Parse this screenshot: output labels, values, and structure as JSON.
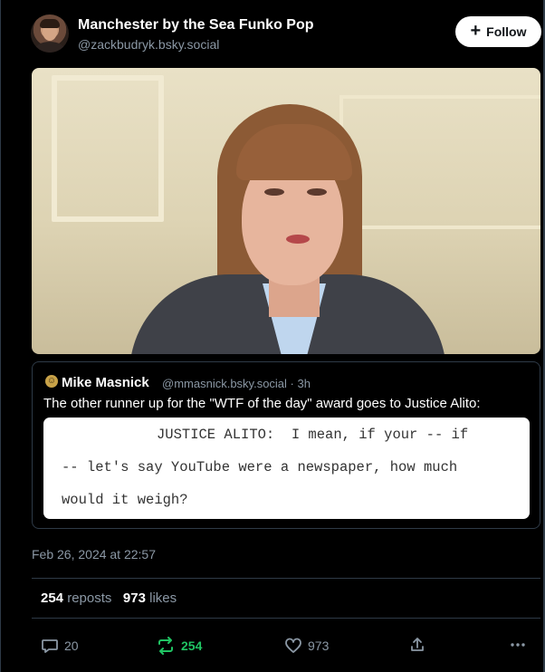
{
  "author": {
    "display_name": "Manchester by the Sea Funko Pop",
    "handle": "@zackbudryk.bsky.social"
  },
  "follow_label": "Follow",
  "quote": {
    "author_name": "Mike Masnick",
    "author_meta": "@mmasnick.bsky.social · 3h",
    "text": "The other runner up for the \"WTF of the day\" award goes to Justice Alito:",
    "image_lines": [
      "JUSTICE ALITO:  I mean, if your -- if",
      "-- let's say YouTube were a newspaper, how much",
      "would it weigh?"
    ]
  },
  "timestamp": "Feb 26, 2024 at 22:57",
  "stats": {
    "reposts_count": "254",
    "reposts_label": "reposts",
    "likes_count": "973",
    "likes_label": "likes"
  },
  "actions": {
    "reply_count": "20",
    "repost_count": "254",
    "like_count": "973"
  },
  "icons": [
    "plus-icon",
    "reply-icon",
    "repost-icon",
    "heart-icon",
    "share-icon",
    "more-icon"
  ],
  "colors": {
    "background": "#000000",
    "muted_text": "#8b98a5",
    "repost_active": "#20c463",
    "border": "#2e3a47"
  }
}
